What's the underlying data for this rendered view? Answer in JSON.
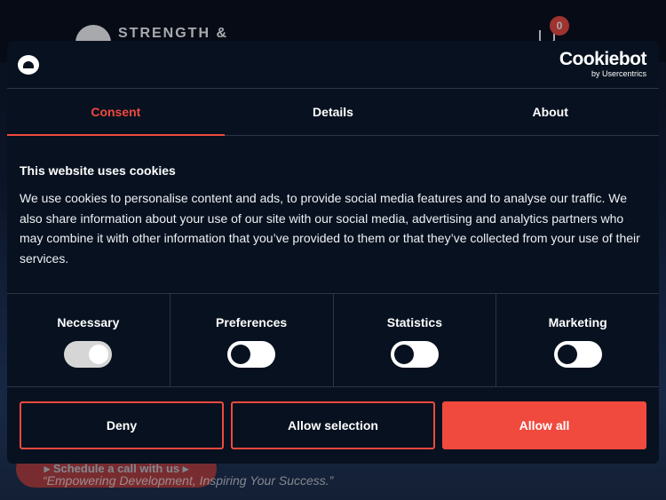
{
  "background": {
    "brand_text": "STRENGTH &",
    "cart_count": "0",
    "cta_label": "▸ Schedule a call with us ▸",
    "tagline": "“Empowering Development, Inspiring Your Success.”"
  },
  "dialog": {
    "cookiebot_name": "Cookiebot",
    "cookiebot_by": "by Usercentrics",
    "tabs": [
      {
        "label": "Consent",
        "active": true
      },
      {
        "label": "Details",
        "active": false
      },
      {
        "label": "About",
        "active": false
      }
    ],
    "title": "This website uses cookies",
    "text": "We use cookies to personalise content and ads, to provide social media features and to analyse our traffic. We also share information about your use of our site with our social media, advertising and analytics partners who may combine it with other information that you’ve provided to them or that they’ve collected from your use of their services.",
    "toggles": [
      {
        "label": "Necessary",
        "checked": true,
        "disabled": true
      },
      {
        "label": "Preferences",
        "checked": false,
        "disabled": false
      },
      {
        "label": "Statistics",
        "checked": false,
        "disabled": false
      },
      {
        "label": "Marketing",
        "checked": false,
        "disabled": false
      }
    ],
    "buttons": {
      "deny": "Deny",
      "allow_selection": "Allow selection",
      "allow_all": "Allow all"
    }
  },
  "colors": {
    "accent": "#f04a3e",
    "dialog_bg": "#07111f"
  }
}
